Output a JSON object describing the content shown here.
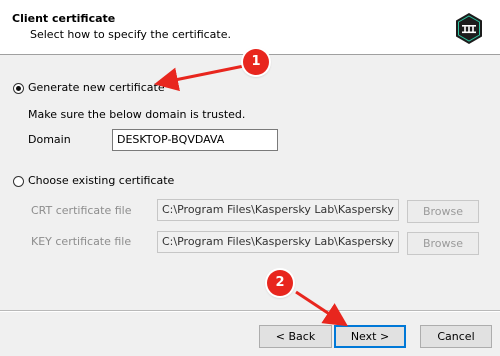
{
  "header": {
    "title": "Client certificate",
    "subtitle": "Select how to specify the certificate.",
    "logo_icon": "kaspersky-security-center-icon"
  },
  "options": {
    "generate": {
      "label": "Generate new certificate",
      "selected": true,
      "note": "Make sure the below domain is trusted.",
      "domain_label": "Domain",
      "domain_value": "DESKTOP-BQVDAVA"
    },
    "existing": {
      "label": "Choose existing certificate",
      "selected": false,
      "crt_label": "CRT certificate file",
      "crt_value": "C:\\Program Files\\Kaspersky Lab\\Kaspersky Secur",
      "crt_browse": "Browse",
      "key_label": "KEY certificate file",
      "key_value": "C:\\Program Files\\Kaspersky Lab\\Kaspersky Secur",
      "key_browse": "Browse"
    }
  },
  "footer": {
    "back_label": "< Back",
    "next_label": "Next >",
    "cancel_label": "Cancel"
  },
  "annotations": {
    "step1": "1",
    "step2": "2",
    "color": "#e8261e"
  }
}
